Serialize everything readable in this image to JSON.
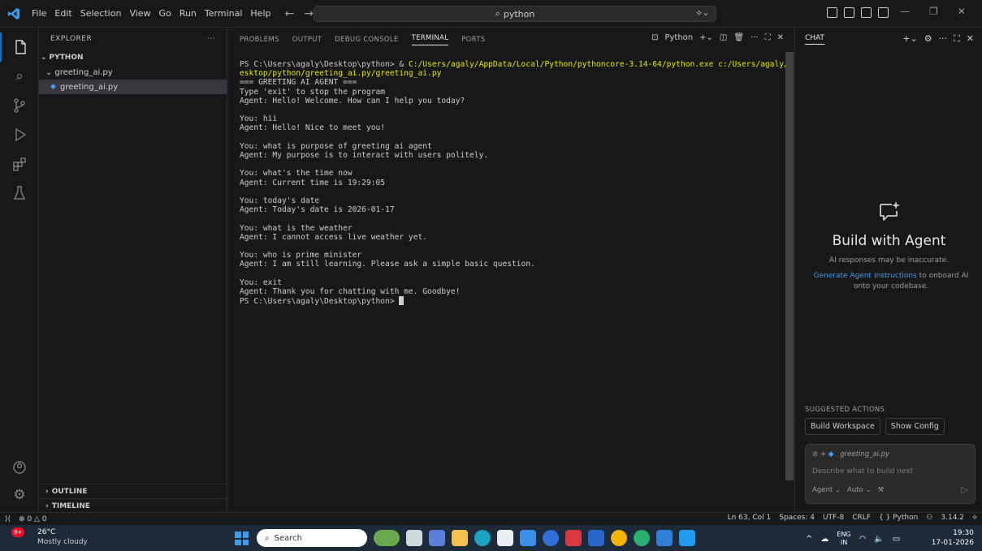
{
  "titlebar": {
    "menu": [
      "File",
      "Edit",
      "Selection",
      "View",
      "Go",
      "Run",
      "Terminal",
      "Help"
    ],
    "search": "python"
  },
  "explorer": {
    "header": "EXPLORER",
    "folder": "PYTHON",
    "subfolder": "greeting_ai.py",
    "file": "greeting_ai.py",
    "outline": "OUTLINE",
    "timeline": "TIMELINE"
  },
  "panel": {
    "tabs": [
      "PROBLEMS",
      "OUTPUT",
      "DEBUG CONSOLE",
      "TERMINAL",
      "PORTS"
    ],
    "active_tab": "TERMINAL",
    "shell_label": "Python"
  },
  "terminal": {
    "cmd_prompt": "PS C:\\Users\\agaly\\Desktop\\python> & ",
    "cmd_exe": "C:/Users/agaly/AppData/Local/Python/pythoncore-3.14-64/python.exe",
    "cmd_arg1": " c:/Users/agaly/D",
    "cmd_arg2": "esktop/python/greeting_ai.py/greeting_ai.py",
    "lines": [
      "=== GREETING AI AGENT ===",
      "Type 'exit' to stop the program",
      "Agent: Hello! Welcome. How can I help you today?",
      "",
      "You: hii",
      "Agent: Hello! Nice to meet you!",
      "",
      "You: what is purpose of greeting ai agent",
      "Agent: My purpose is to interact with users politely.",
      "",
      "You: what's the time now",
      "Agent: Current time is 19:29:05",
      "",
      "You: today's date",
      "Agent: Today's date is 2026-01-17",
      "",
      "You: what is the weather",
      "Agent: I cannot access live weather yet.",
      "",
      "You: who is prime minister",
      "Agent: I am still learning. Please ask a simple basic question.",
      "",
      "You: exit",
      "Agent: Thank you for chatting with me. Goodbye!"
    ],
    "final_prompt": "PS C:\\Users\\agaly\\Desktop\\python> "
  },
  "chat": {
    "header": "CHAT",
    "title": "Build with Agent",
    "subtitle": "AI responses may be inaccurate.",
    "link": "Generate Agent Instructions",
    "desc_rest": " to onboard AI onto your codebase.",
    "suggested_header": "SUGGESTED ACTIONS",
    "actions": [
      "Build Workspace",
      "Show Config"
    ],
    "context_file": "greeting_ai.py",
    "placeholder": "Describe what to build next",
    "mode": "Agent",
    "model": "Auto"
  },
  "status": {
    "errors": "0",
    "warnings": "0",
    "position": "Ln 63, Col 1",
    "spaces": "Spaces: 4",
    "encoding": "UTF-8",
    "eol": "CRLF",
    "language": "{ } Python",
    "version": "3.14.2"
  },
  "taskbar": {
    "badge": "9+",
    "temp": "26°C",
    "weather": "Mostly cloudy",
    "search": "Search",
    "lang1": "ENG",
    "lang2": "IN",
    "time": "19:30",
    "date": "17-01-2026"
  },
  "colors": {
    "accent": "#0078d4",
    "link": "#3b9cf0",
    "terminal_path": "#e5e510"
  }
}
